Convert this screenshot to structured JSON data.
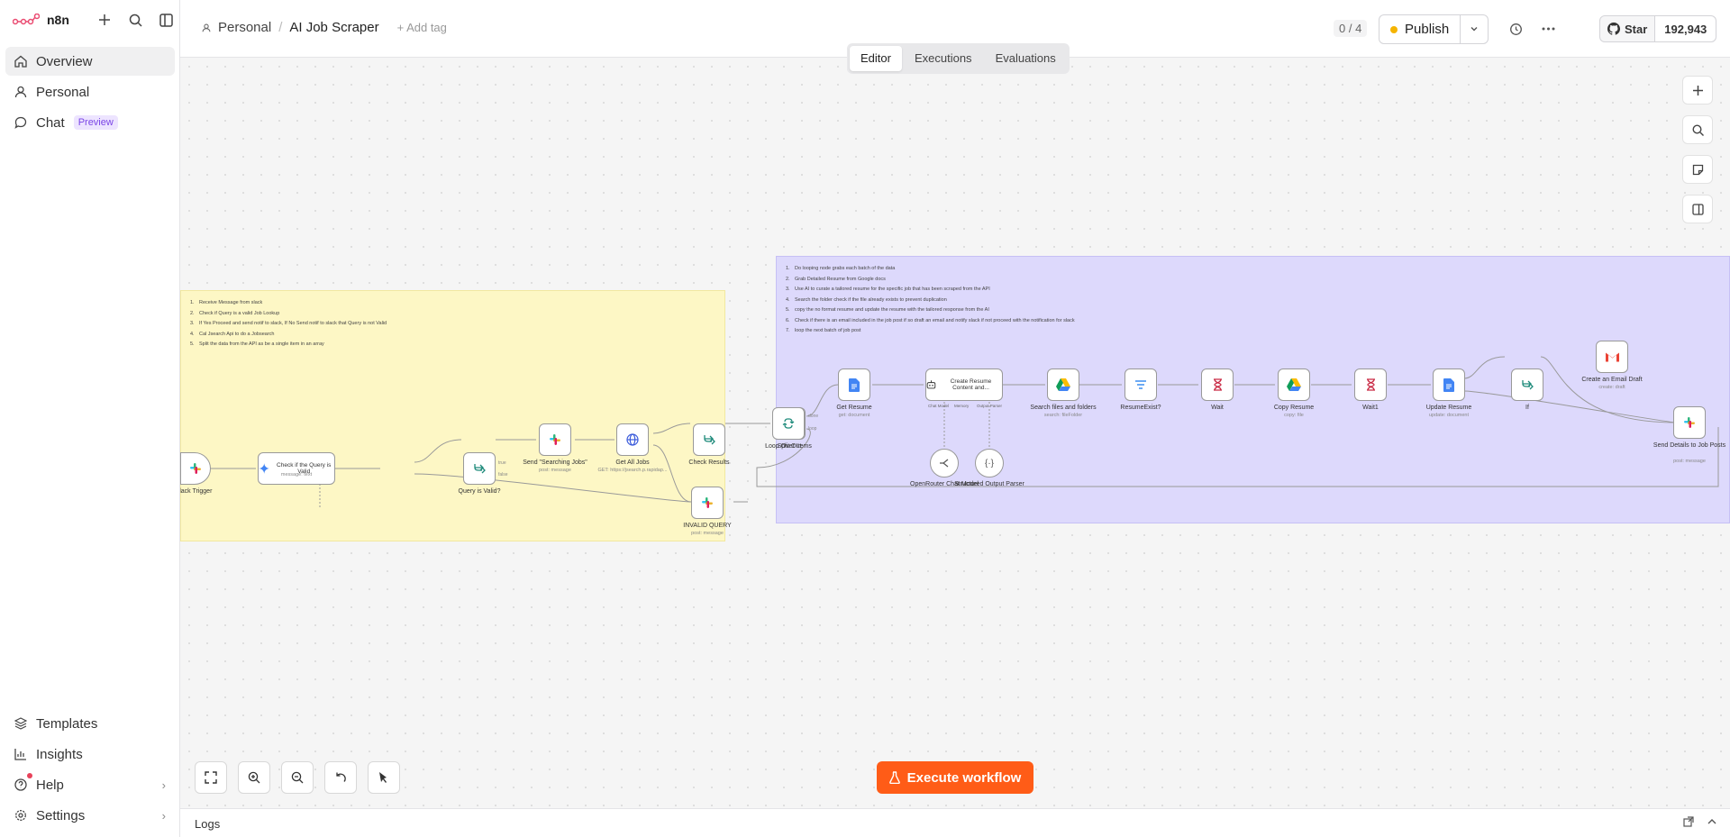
{
  "app": {
    "brand": "n8n"
  },
  "sidebar": {
    "items": [
      {
        "label": "Overview",
        "icon": "home-icon"
      },
      {
        "label": "Personal",
        "icon": "user-icon"
      },
      {
        "label": "Chat",
        "icon": "chat-icon",
        "badge": "Preview"
      }
    ],
    "bottom": [
      {
        "label": "Templates",
        "icon": "templates-icon"
      },
      {
        "label": "Insights",
        "icon": "chart-icon"
      },
      {
        "label": "Help",
        "icon": "help-icon"
      },
      {
        "label": "Settings",
        "icon": "gear-icon"
      }
    ]
  },
  "header": {
    "project": "Personal",
    "workflow": "AI Job Scraper",
    "add_tag": "+ Add tag",
    "counter": "0 / 4",
    "publish": "Publish",
    "github_star": "Star",
    "github_count": "192,943"
  },
  "tabs": [
    "Editor",
    "Executions",
    "Evaluations"
  ],
  "canvas": {
    "execute": "Execute workflow",
    "logs": "Logs",
    "note_yellow": [
      "Receive Message from slack",
      "Check if Query is a valid Job Lookup",
      "If Yes Proceed and send notif to slack, If No Send notif to slack that Query is not Valid",
      "Cal Jsearch Api to do a Jobsearch",
      "Split the data from the API as be a single item in an array"
    ],
    "note_purple": [
      "Do looping node grabs each batch of the data",
      "Grab Detailed Resume from Google docs",
      "Use AI to curate a tailored resume for the specific job that has been scraped from the API",
      "Search the folder check if the file already exists to prevent duplication",
      "copy the no format resume and update the resume with the tailored response from the AI",
      "Check if there is an email included in the job post if so draft an email and notify slack if not proceed with the notification for slack",
      "loop the next batch of job post"
    ],
    "nodes": {
      "slack_trigger": "Slack Trigger",
      "check_query": "Check if the Query is Valid",
      "check_query_sub": "message: text",
      "query_valid": "Query is Valid?",
      "send_searching": "Send \"Searching Jobs\"",
      "send_searching_sub": "post: message",
      "get_jobs": "Get All Jobs",
      "get_jobs_sub": "GET: https://jsearch.p.rapidap...",
      "check_results": "Check Results",
      "split_out": "Split Out",
      "invalid_query": "INVALID QUERY",
      "invalid_query_sub": "post: message",
      "loop": "Loop Over Items",
      "get_resume": "Get Resume",
      "get_resume_sub": "get: document",
      "create_resume": "Create Resume Content and...",
      "openrouter": "OpenRouter Chat Model",
      "structured": "Structured Output Parser",
      "search_files": "Search files and folders",
      "search_files_sub": "search: fileFolder",
      "resume_exist": "ResumeExist?",
      "wait": "Wait",
      "copy_resume": "Copy Resume",
      "copy_resume_sub": "copy: file",
      "wait1": "Wait1",
      "update_resume": "Update Resume",
      "update_resume_sub": "update: document",
      "if": "If",
      "email_draft": "Create an Email Draft",
      "email_draft_sub": "create: draft",
      "send_details": "Send Details to Job Posts",
      "send_details_sub": "post: message",
      "port_true": "true",
      "port_false": "false",
      "port_done": "done",
      "port_loop": "loop",
      "port_chat": "Chat Model",
      "port_memory": "Memory",
      "port_output": "Output Parser",
      "port_model": "Model"
    }
  },
  "colors": {
    "accent": "#ff5c17",
    "publish_dot": "#f5b400",
    "sticky_yellow": "#fdf7c5",
    "sticky_purple": "#ddd9fc"
  }
}
